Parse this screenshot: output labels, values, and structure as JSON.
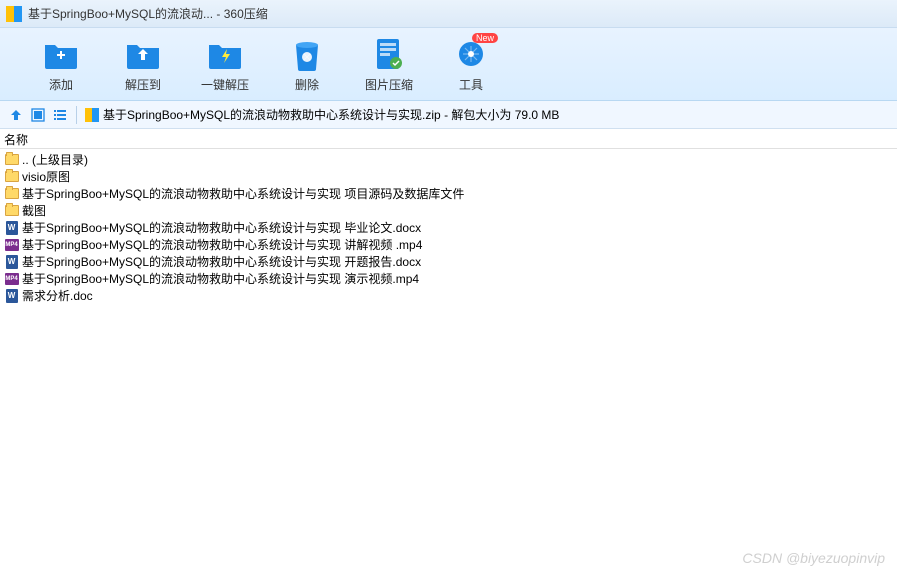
{
  "window": {
    "title": "基于SpringBoo+MySQL的流浪动... - 360压缩"
  },
  "toolbar": {
    "add": "添加",
    "extract_to": "解压到",
    "one_click": "一键解压",
    "delete": "删除",
    "image_compress": "图片压缩",
    "tools": "工具",
    "badge_new": "New"
  },
  "navbar": {
    "path": "基于SpringBoo+MySQL的流浪动物救助中心系统设计与实现.zip - 解包大小为 79.0 MB"
  },
  "columns": {
    "name": "名称"
  },
  "files": [
    {
      "type": "folder",
      "name": ".. (上级目录)"
    },
    {
      "type": "folder",
      "name": "visio原图"
    },
    {
      "type": "folder",
      "name": "基于SpringBoo+MySQL的流浪动物救助中心系统设计与实现 项目源码及数据库文件"
    },
    {
      "type": "folder",
      "name": "截图"
    },
    {
      "type": "docx",
      "name": "基于SpringBoo+MySQL的流浪动物救助中心系统设计与实现 毕业论文.docx"
    },
    {
      "type": "mp4",
      "name": "基于SpringBoo+MySQL的流浪动物救助中心系统设计与实现 讲解视频 .mp4"
    },
    {
      "type": "docx",
      "name": "基于SpringBoo+MySQL的流浪动物救助中心系统设计与实现 开题报告.docx"
    },
    {
      "type": "mp4",
      "name": "基于SpringBoo+MySQL的流浪动物救助中心系统设计与实现 演示视频.mp4"
    },
    {
      "type": "doc",
      "name": "需求分析.doc"
    }
  ],
  "watermark": "CSDN @biyezuopinvip"
}
